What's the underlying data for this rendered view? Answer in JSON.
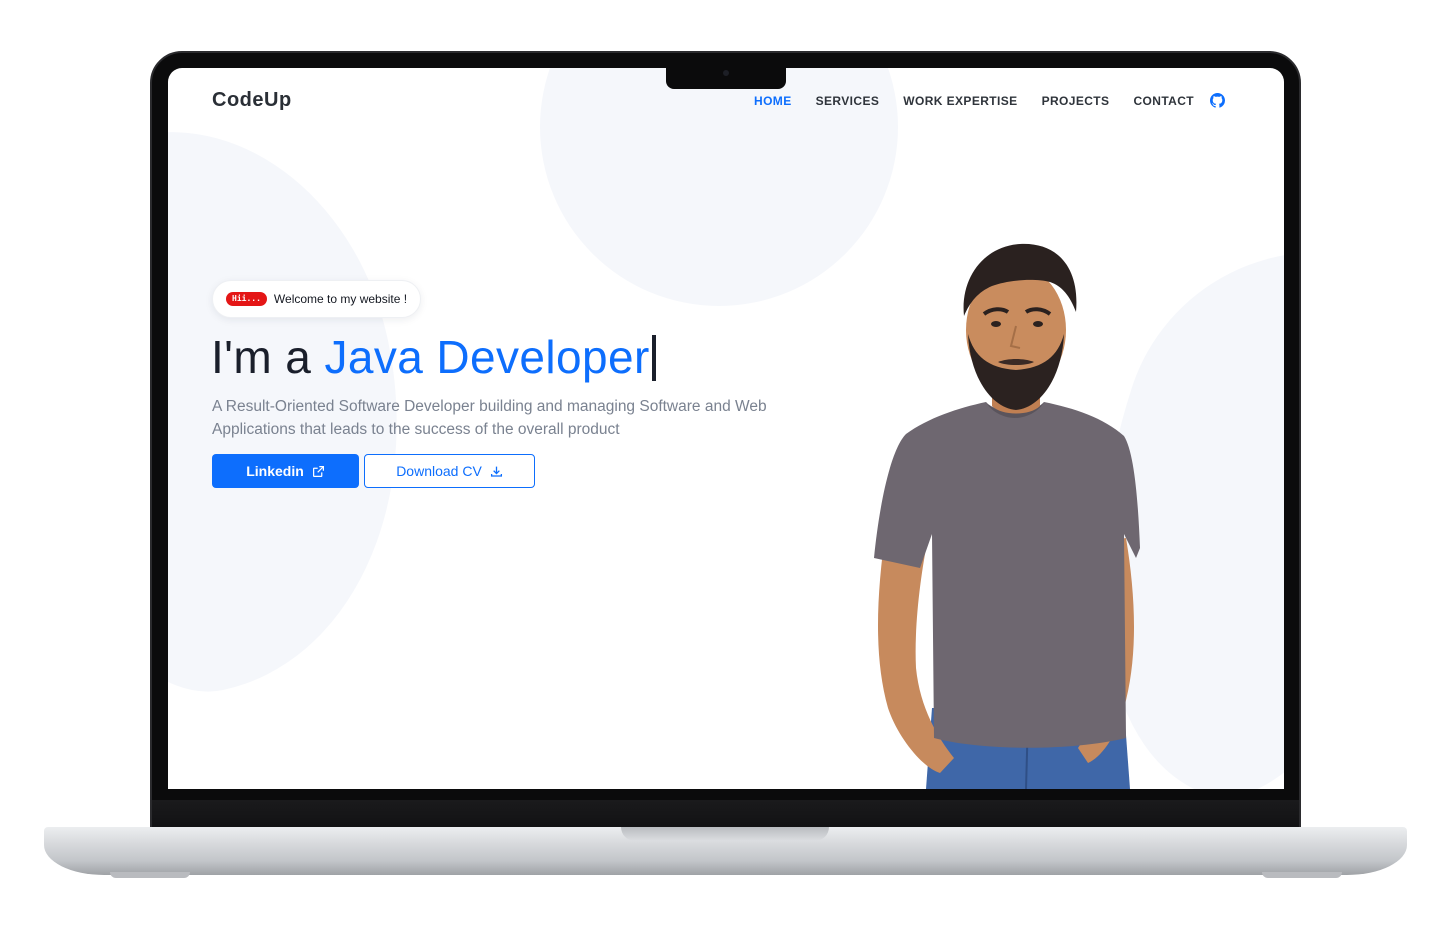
{
  "site": {
    "brand": "CodeUp"
  },
  "nav": {
    "items": [
      {
        "label": "HOME",
        "active": true
      },
      {
        "label": "SERVICES",
        "active": false
      },
      {
        "label": "WORK EXPERTISE",
        "active": false
      },
      {
        "label": "PROJECTS",
        "active": false
      },
      {
        "label": "CONTACT",
        "active": false
      }
    ],
    "github_icon": "github-icon"
  },
  "hero": {
    "badge": "Hii...",
    "welcome": "Welcome to my website !",
    "headline_prefix": "I'm a ",
    "headline_role": "Java Developer",
    "description": "A Result-Oriented Software Developer building and managing Software and Web Applications that leads to the success of the overall product",
    "buttons": {
      "linkedin": "Linkedin",
      "download_cv": "Download CV"
    }
  },
  "colors": {
    "accent": "#0d6efd",
    "badge": "#e41616",
    "text_dark": "#1a1f2b",
    "text_muted": "#7a8290",
    "blob": "#f5f7fb"
  },
  "icons": {
    "linkedin_button": "external-link-icon",
    "download_button": "download-icon"
  }
}
